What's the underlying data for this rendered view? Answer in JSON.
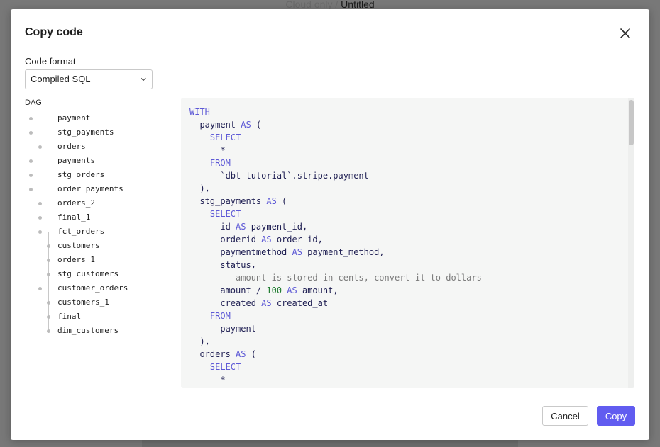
{
  "backdrop": {
    "breadcrumb_prefix": "Cloud only",
    "breadcrumb_separator": " / ",
    "breadcrumb_current": "Untitled"
  },
  "dialog": {
    "title": "Copy code",
    "close_icon": "close-icon"
  },
  "format": {
    "label": "Code format",
    "selected": "Compiled SQL",
    "chevron_icon": "chevron-down-icon"
  },
  "dag": {
    "label": "DAG",
    "items": [
      "payment",
      "stg_payments",
      "orders",
      "payments",
      "stg_orders",
      "order_payments",
      "orders_2",
      "final_1",
      "fct_orders",
      "customers",
      "orders_1",
      "stg_customers",
      "customer_orders",
      "customers_1",
      "final",
      "dim_customers"
    ]
  },
  "code": {
    "lines": [
      [
        {
          "t": "kw",
          "v": "WITH"
        }
      ],
      [
        {
          "t": "id",
          "v": "  payment "
        },
        {
          "t": "kw",
          "v": "AS"
        },
        {
          "t": "id",
          "v": " ("
        }
      ],
      [
        {
          "t": "kw",
          "v": "    SELECT"
        }
      ],
      [
        {
          "t": "id",
          "v": "      *"
        }
      ],
      [
        {
          "t": "kw",
          "v": "    FROM"
        }
      ],
      [
        {
          "t": "id",
          "v": "      `dbt-tutorial`.stripe.payment"
        }
      ],
      [
        {
          "t": "id",
          "v": "  ),"
        }
      ],
      [
        {
          "t": "id",
          "v": "  stg_payments "
        },
        {
          "t": "kw",
          "v": "AS"
        },
        {
          "t": "id",
          "v": " ("
        }
      ],
      [
        {
          "t": "kw",
          "v": "    SELECT"
        }
      ],
      [
        {
          "t": "id",
          "v": "      id "
        },
        {
          "t": "kw",
          "v": "AS"
        },
        {
          "t": "id",
          "v": " payment_id,"
        }
      ],
      [
        {
          "t": "id",
          "v": "      orderid "
        },
        {
          "t": "kw",
          "v": "AS"
        },
        {
          "t": "id",
          "v": " order_id,"
        }
      ],
      [
        {
          "t": "id",
          "v": "      paymentmethod "
        },
        {
          "t": "kw",
          "v": "AS"
        },
        {
          "t": "id",
          "v": " payment_method,"
        }
      ],
      [
        {
          "t": "id",
          "v": "      status,"
        }
      ],
      [
        {
          "t": "cmt",
          "v": "      -- amount is stored in cents, convert it to dollars"
        }
      ],
      [
        {
          "t": "id",
          "v": "      amount / "
        },
        {
          "t": "num",
          "v": "100"
        },
        {
          "t": "id",
          "v": " "
        },
        {
          "t": "kw",
          "v": "AS"
        },
        {
          "t": "id",
          "v": " amount,"
        }
      ],
      [
        {
          "t": "id",
          "v": "      created "
        },
        {
          "t": "kw",
          "v": "AS"
        },
        {
          "t": "id",
          "v": " created_at"
        }
      ],
      [
        {
          "t": "kw",
          "v": "    FROM"
        }
      ],
      [
        {
          "t": "id",
          "v": "      payment"
        }
      ],
      [
        {
          "t": "id",
          "v": "  ),"
        }
      ],
      [
        {
          "t": "id",
          "v": "  orders "
        },
        {
          "t": "kw",
          "v": "AS"
        },
        {
          "t": "id",
          "v": " ("
        }
      ],
      [
        {
          "t": "kw",
          "v": "    SELECT"
        }
      ],
      [
        {
          "t": "id",
          "v": "      *"
        }
      ]
    ]
  },
  "footer": {
    "cancel_label": "Cancel",
    "copy_label": "Copy"
  },
  "colors": {
    "accent": "#615cf0",
    "keyword": "#5d59d6",
    "number": "#1e7b2e",
    "comment": "#7b7b7b",
    "identifier": "#1e1e52"
  }
}
